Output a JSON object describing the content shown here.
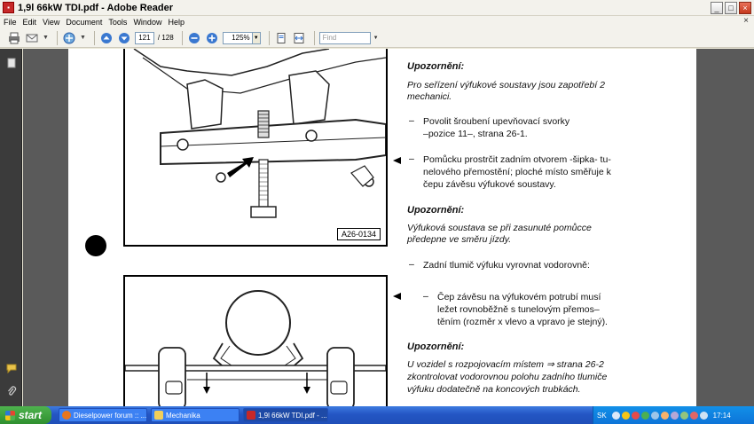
{
  "window": {
    "title": "1,9l 66kW TDI.pdf - Adobe Reader",
    "app_icon": "pdf-icon",
    "controls": {
      "minimize": "_",
      "maximize": "□",
      "close": "×"
    }
  },
  "menu": {
    "items": [
      "File",
      "Edit",
      "View",
      "Document",
      "Tools",
      "Window",
      "Help"
    ],
    "doc_close": "×"
  },
  "toolbar": {
    "page_current": "121",
    "page_total": "/ 128",
    "zoom": "125%",
    "find_placeholder": "Find"
  },
  "document": {
    "figure_top_label": "A26-0134",
    "sections": {
      "note1_heading": "Upozornění:",
      "note1_text_1": "Pro seřízení výfukové soustavy jsou zapotřebí 2",
      "note1_text_2": "mechanici.",
      "item1_1": "Povolit šroubení upevňovací svorky",
      "item1_2": "–pozice 11–, strana 26-1.",
      "item2_1": "Pomůcku prostrčit zadním otvorem -šipka- tu-",
      "item2_2": "nelového přemostění; ploché místo směřuje k",
      "item2_3": "čepu závěsu výfukové soustavy.",
      "note2_heading": "Upozornění:",
      "note2_text_1": "Výfuková soustava se při zasunuté pomůcce",
      "note2_text_2": "předepne ve směru jízdy.",
      "item3": "Zadní tlumič výfuku vyrovnat vodorovně:",
      "item4_1": "Čep závěsu na výfukovém potrubí musí",
      "item4_2": "ležet rovnoběžně s tunelovým přemos–",
      "item4_3": "těním (rozměr x vlevo a vpravo je stejný).",
      "note3_heading": "Upozornění:",
      "note3_text_1": "U vozidel s rozpojovacím místem ⇒ strana 26-2",
      "note3_text_2": "zkontrolovat vodorovnou polohu zadního tlumiče",
      "note3_text_3": "výfuku dodatečně na koncových trubkách."
    },
    "dash": "–"
  },
  "taskbar": {
    "start_label": "start",
    "tasks": [
      {
        "label": "Dieselpower forum :: ...",
        "icon": "firefox-icon",
        "color": "#e8761e"
      },
      {
        "label": "Mechanika",
        "icon": "folder-icon",
        "color": "#f2cf5a"
      },
      {
        "label": "1,9l 66kW TDI.pdf - ...",
        "icon": "pdf-icon",
        "color": "#c62828"
      }
    ],
    "language": "SK",
    "clock": "17:14"
  }
}
